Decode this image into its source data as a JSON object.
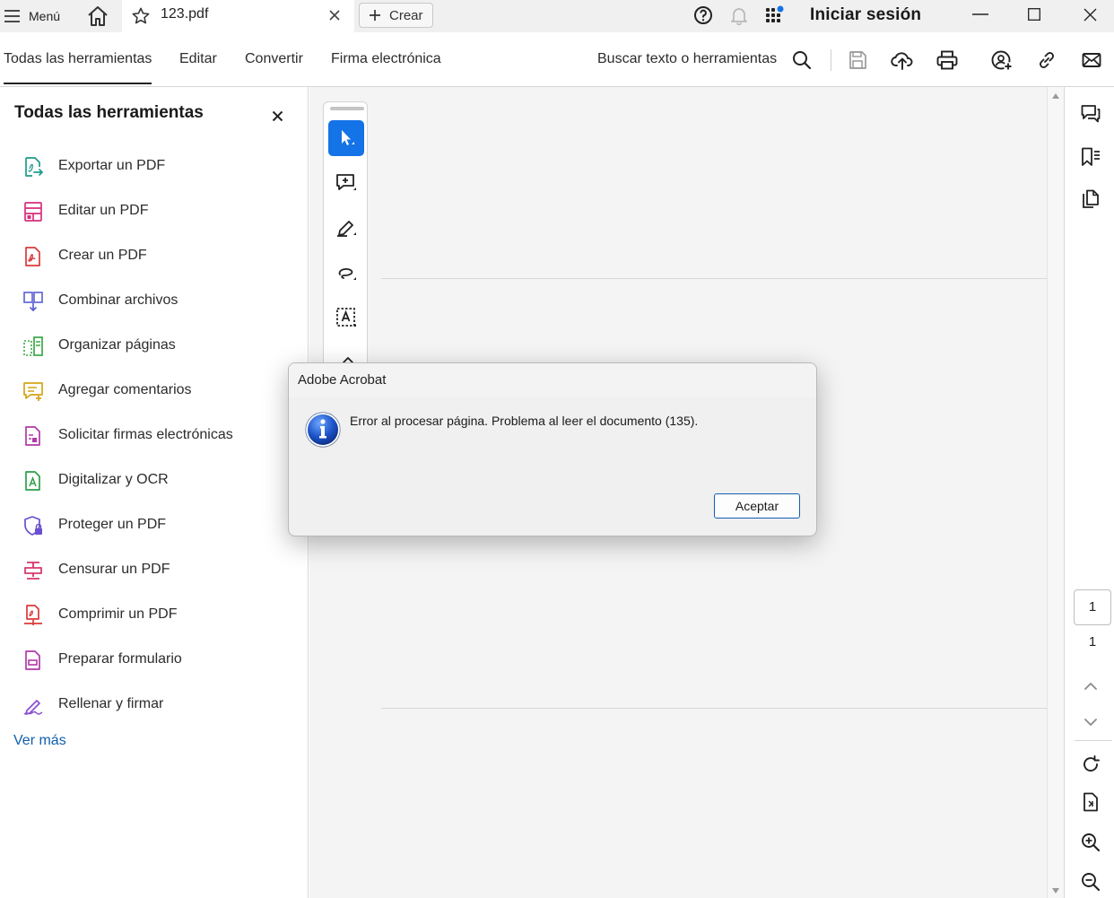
{
  "titlebar": {
    "menu_label": "Menú",
    "tab_name": "123.pdf",
    "create_label": "Crear",
    "signin_label": "Iniciar sesión"
  },
  "toolbar": {
    "tabs": [
      "Todas las herramientas",
      "Editar",
      "Convertir",
      "Firma electrónica"
    ],
    "search_label": "Buscar texto o herramientas"
  },
  "left_panel": {
    "title": "Todas las herramientas",
    "tools": [
      {
        "label": "Exportar un PDF",
        "icon": "export-pdf-icon",
        "color": "#1b9c8c"
      },
      {
        "label": "Editar un PDF",
        "icon": "edit-pdf-icon",
        "color": "#d62f7c"
      },
      {
        "label": "Crear un PDF",
        "icon": "create-pdf-icon",
        "color": "#d93a3a"
      },
      {
        "label": "Combinar archivos",
        "icon": "combine-files-icon",
        "color": "#5a5fd0"
      },
      {
        "label": "Organizar páginas",
        "icon": "organize-pages-icon",
        "color": "#3aa844"
      },
      {
        "label": "Agregar comentarios",
        "icon": "add-comment-icon",
        "color": "#d4a417"
      },
      {
        "label": "Solicitar firmas electrónicas",
        "icon": "request-signatures-icon",
        "color": "#b03aa8"
      },
      {
        "label": "Digitalizar y OCR",
        "icon": "scan-ocr-icon",
        "color": "#2e9f4a"
      },
      {
        "label": "Proteger un PDF",
        "icon": "protect-pdf-icon",
        "color": "#6a4fd0"
      },
      {
        "label": "Censurar un PDF",
        "icon": "redact-pdf-icon",
        "color": "#d4356a"
      },
      {
        "label": "Comprimir un PDF",
        "icon": "compress-pdf-icon",
        "color": "#d93a3a"
      },
      {
        "label": "Preparar formulario",
        "icon": "prepare-form-icon",
        "color": "#b03aa8"
      },
      {
        "label": "Rellenar y firmar",
        "icon": "fill-sign-icon",
        "color": "#8a4fd0"
      }
    ],
    "see_more": "Ver más"
  },
  "page_nav": {
    "current": "1",
    "total": "1"
  },
  "dialog": {
    "title": "Adobe Acrobat",
    "message": "Error al procesar página. Problema al leer el documento (135).",
    "ok_label": "Aceptar"
  },
  "colors": {
    "accent": "#1473e6",
    "link": "#1060b0"
  }
}
